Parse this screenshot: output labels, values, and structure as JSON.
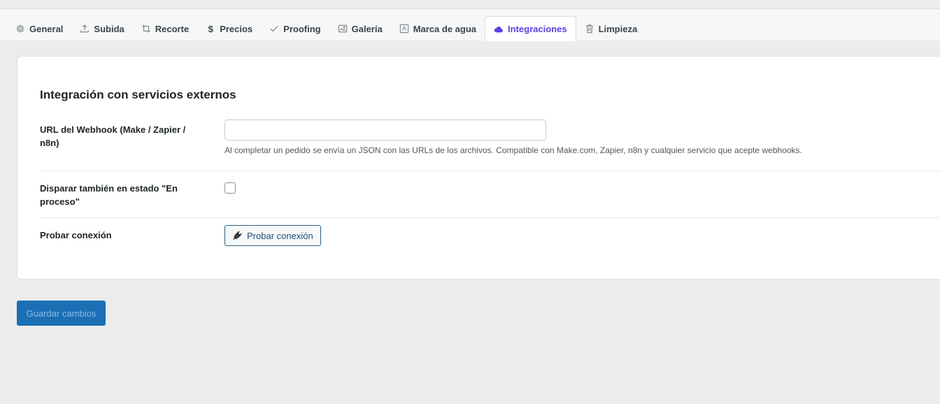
{
  "tabs": [
    {
      "label": "General",
      "icon": "gear-icon"
    },
    {
      "label": "Subida",
      "icon": "upload-icon"
    },
    {
      "label": "Recorte",
      "icon": "crop-icon"
    },
    {
      "label": "Precios",
      "icon": "dollar-icon"
    },
    {
      "label": "Proofing",
      "icon": "checkmark-icon"
    },
    {
      "label": "Galería",
      "icon": "image-icon"
    },
    {
      "label": "Marca de agua",
      "icon": "watermark-icon"
    },
    {
      "label": "Integraciones",
      "icon": "cloud-icon",
      "active": true
    },
    {
      "label": "Limpieza",
      "icon": "trash-icon"
    }
  ],
  "panel": {
    "title": "Integración con servicios externos",
    "webhook": {
      "label": "URL del Webhook (Make / Zapier / n8n)",
      "value": "",
      "help": "Al completar un pedido se envía un JSON con las URLs de los archivos. Compatible con Make.com, Zapier, n8n y cualquier servicio que acepte webhooks."
    },
    "trigger": {
      "label": "Disparar también en estado \"En proceso\"",
      "checked": false
    },
    "test": {
      "label": "Probar conexión",
      "button_label": "Probar conexión",
      "icon": "plug-icon"
    }
  },
  "save_label": "Guardar cambios",
  "colors": {
    "active_tab": "#5b3fe0",
    "primary_button": "#1a6fb5"
  }
}
